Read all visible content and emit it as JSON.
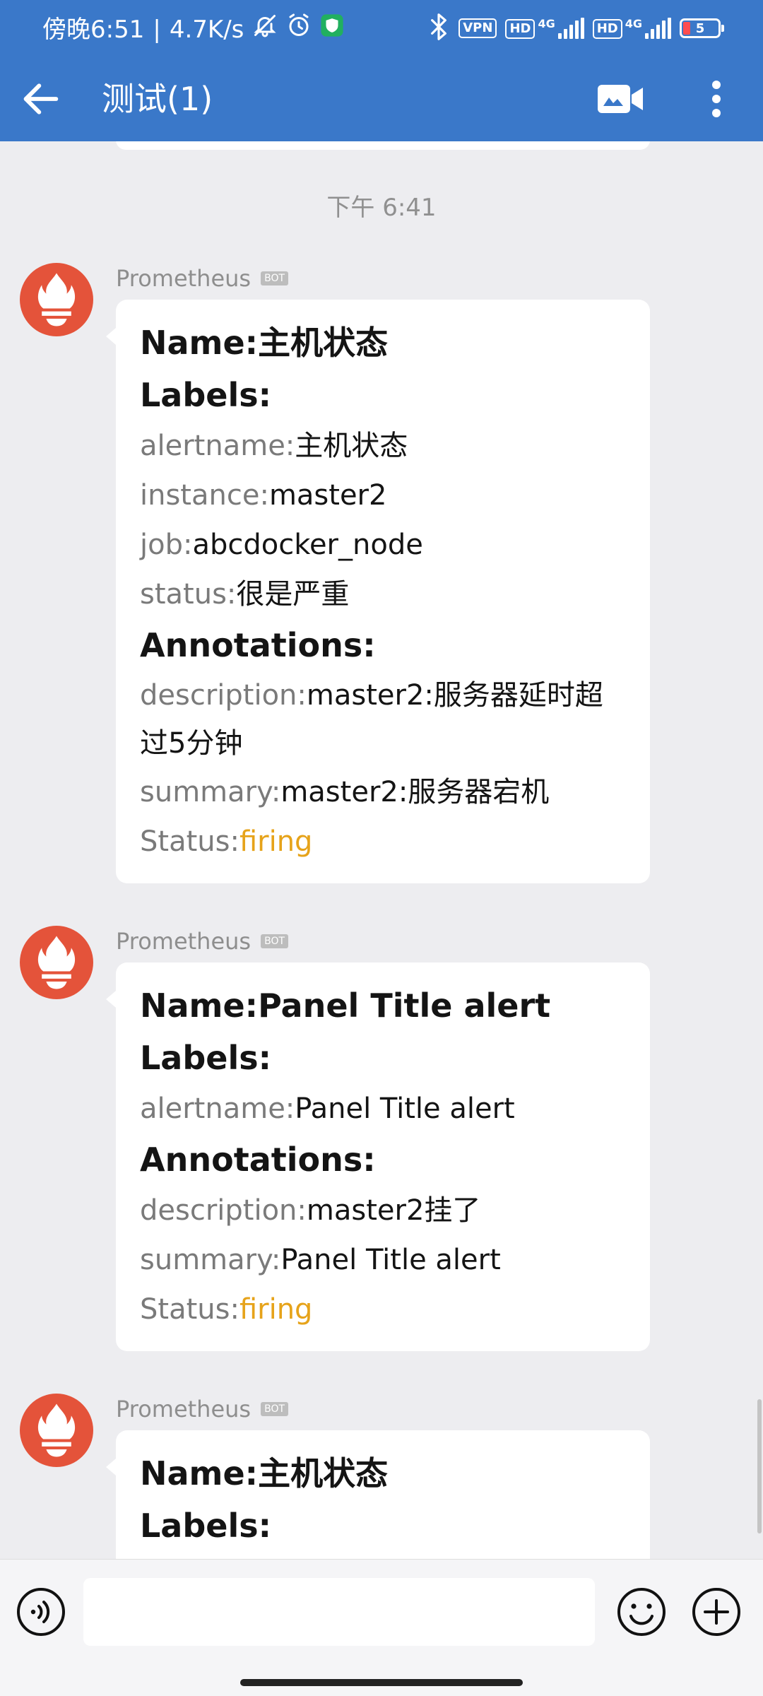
{
  "status_bar": {
    "time": "傍晚6:51",
    "separator": "|",
    "speed": "4.7K/s",
    "vpn_label": "VPN",
    "hd_label": "HD",
    "net_label": "4G",
    "battery_level": "5",
    "icons": [
      "mute-bell-icon",
      "alarm-icon",
      "shield-app-icon",
      "bluetooth-icon",
      "signal-icon",
      "battery-icon"
    ]
  },
  "app_bar": {
    "title": "测试(1)",
    "icons": [
      "back-arrow-icon",
      "video-call-icon",
      "more-vertical-icon"
    ]
  },
  "chat": {
    "time_divider": "下午 6:41",
    "messages": [
      {
        "sender": "Prometheus",
        "badge": "BOT",
        "name_label": "Name:",
        "name_value": "主机状态",
        "labels_heading": "Labels:",
        "labels": [
          {
            "key": "alertname:",
            "value": "主机状态"
          },
          {
            "key": "instance:",
            "value": "master2"
          },
          {
            "key": "job:",
            "value": "abcdocker_node"
          },
          {
            "key": "status:",
            "value": "很是严重"
          }
        ],
        "annotations_heading": "Annotations:",
        "annotations": [
          {
            "key": "description:",
            "value": "master2:服务器延时超过5分钟"
          },
          {
            "key": "summary:",
            "value": "master2:服务器宕机"
          }
        ],
        "status_key": "Status:",
        "status_value": "firing"
      },
      {
        "sender": "Prometheus",
        "badge": "BOT",
        "name_label": "Name:",
        "name_value": "Panel Title alert",
        "labels_heading": "Labels:",
        "labels": [
          {
            "key": "alertname:",
            "value": "Panel Title alert"
          }
        ],
        "annotations_heading": "Annotations:",
        "annotations": [
          {
            "key": "description:",
            "value": "master2挂了"
          },
          {
            "key": "summary:",
            "value": "Panel Title alert"
          }
        ],
        "status_key": "Status:",
        "status_value": "firing"
      },
      {
        "sender": "Prometheus",
        "badge": "BOT",
        "name_label": "Name:",
        "name_value": "主机状态",
        "labels_heading": "Labels:"
      }
    ]
  },
  "input_bar": {
    "placeholder": "",
    "icons": [
      "voice-input-icon",
      "emoji-icon",
      "plus-icon"
    ]
  },
  "colors": {
    "header_blue": "#3a78c9",
    "background": "#ededf0",
    "firing": "#e6a31a",
    "avatar_red": "#e4533a"
  }
}
